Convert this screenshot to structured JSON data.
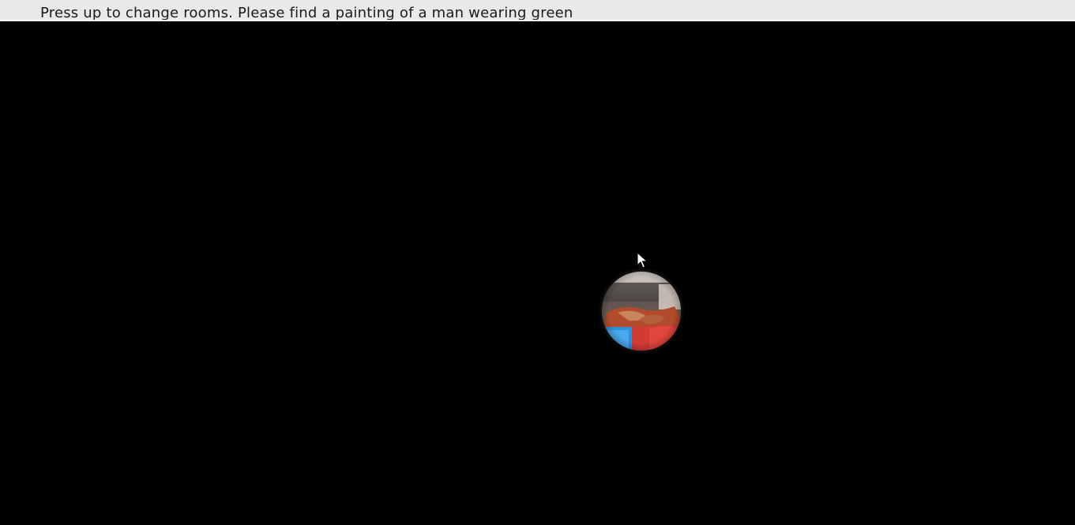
{
  "header": {
    "instruction": "Press up to change rooms. Please find a painting of a man wearing green"
  },
  "scene": {
    "background_color": "#000000",
    "spotlight_icon": "flashlight-view-icon",
    "cursor_icon": "mouse-pointer-icon"
  }
}
